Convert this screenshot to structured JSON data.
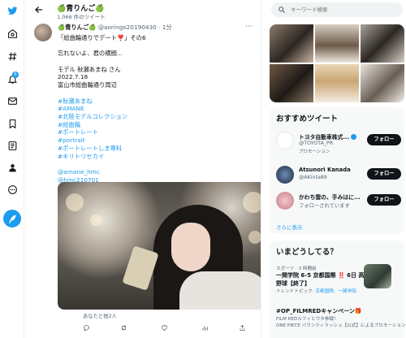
{
  "header": {
    "name": "🍏青りんご🍏",
    "tweet_count": "1,066 件のツイート"
  },
  "nav": {
    "notification_badge": "6"
  },
  "tweet": {
    "author_name": "🍏青りんご🍏",
    "handle": "@aoringo20190430",
    "time": "· 1分",
    "lines": [
      "「総曲輪通りでデート❣️」その6",
      "",
      "忘れないよ、君の横顔...",
      "",
      "モデル 秋瀬あまね さん",
      "2022.7.18",
      "富山市総曲輪通り周辺",
      ""
    ],
    "hashtags": [
      "#秋瀬あまね",
      "#AMANE",
      "#北陸モデルコレクション",
      "#総曲輪",
      "#ポートレート",
      "#portrait",
      "#ポートレートしま専科",
      "#キリトリセカイ"
    ],
    "mentions": [
      "@amane_hmc",
      "@hmc210701"
    ],
    "tagged_text": "あなたと他2人",
    "actions": {
      "reply": "",
      "retweet": "",
      "like": "",
      "share": ""
    }
  },
  "right": {
    "search_placeholder": "キーワード検索",
    "recommend_title": "おすすめツイート",
    "recommendations": [
      {
        "name": "トヨタ自動車株式...",
        "handle": "@TOYOTA_PR",
        "sub": "プロモーション",
        "button": "フォロー"
      },
      {
        "name": "Atsunori Kanada",
        "handle": "@AKinta89",
        "sub": "",
        "button": "フォロー"
      },
      {
        "name": "かわち雲の、手みはに...",
        "handle": "",
        "sub": "フォローされています",
        "button": "フォロー"
      }
    ],
    "show_more": "さらに表示",
    "trends_title": "いまどうしてる？",
    "trends": [
      {
        "meta": "スポーツ · 3 時間前",
        "title": "一関学院 6-5 京都国際 ‼️ 6日 高校野球【終了】",
        "sub_prefix": "トレンドトピック: ",
        "sub_links": "京都国際、一関学院"
      },
      {
        "meta": "",
        "title": "#OP_FILMREDキャンペーン🎁",
        "sub_prefix": "FILM REDルフィとウタ参戦！",
        "sub_links": ""
      },
      {
        "meta": "",
        "title": "",
        "sub_prefix": "ONE PIECE バウンティラッシュ【公式】によるプロモーション",
        "sub_links": ""
      }
    ]
  },
  "colors": {
    "accent": "#1d9bf0",
    "text": "#0f1419",
    "muted": "#536471"
  }
}
